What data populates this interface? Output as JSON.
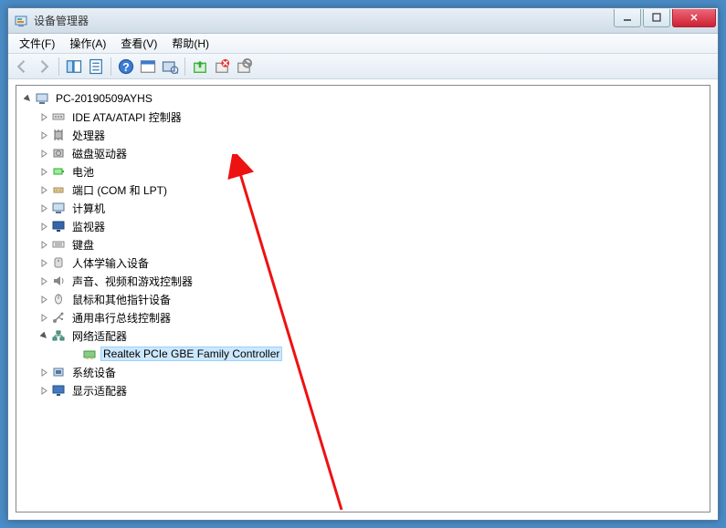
{
  "title": "设备管理器",
  "menu": {
    "file": "文件(F)",
    "action": "操作(A)",
    "view": "查看(V)",
    "help": "帮助(H)"
  },
  "tree": {
    "root": "PC-20190509AYHS",
    "items": [
      {
        "label": "IDE ATA/ATAPI 控制器",
        "icon": "ide"
      },
      {
        "label": "处理器",
        "icon": "cpu"
      },
      {
        "label": "磁盘驱动器",
        "icon": "disk"
      },
      {
        "label": "电池",
        "icon": "battery"
      },
      {
        "label": "端口 (COM 和 LPT)",
        "icon": "port"
      },
      {
        "label": "计算机",
        "icon": "computer"
      },
      {
        "label": "监视器",
        "icon": "monitor"
      },
      {
        "label": "键盘",
        "icon": "keyboard"
      },
      {
        "label": "人体学输入设备",
        "icon": "hid"
      },
      {
        "label": "声音、视频和游戏控制器",
        "icon": "sound"
      },
      {
        "label": "鼠标和其他指针设备",
        "icon": "mouse"
      },
      {
        "label": "通用串行总线控制器",
        "icon": "usb"
      },
      {
        "label": "网络适配器",
        "icon": "network",
        "expanded": true,
        "children": [
          {
            "label": "Realtek PCIe GBE Family Controller",
            "icon": "netcard",
            "selected": true
          }
        ]
      },
      {
        "label": "系统设备",
        "icon": "system"
      },
      {
        "label": "显示适配器",
        "icon": "display"
      }
    ]
  }
}
